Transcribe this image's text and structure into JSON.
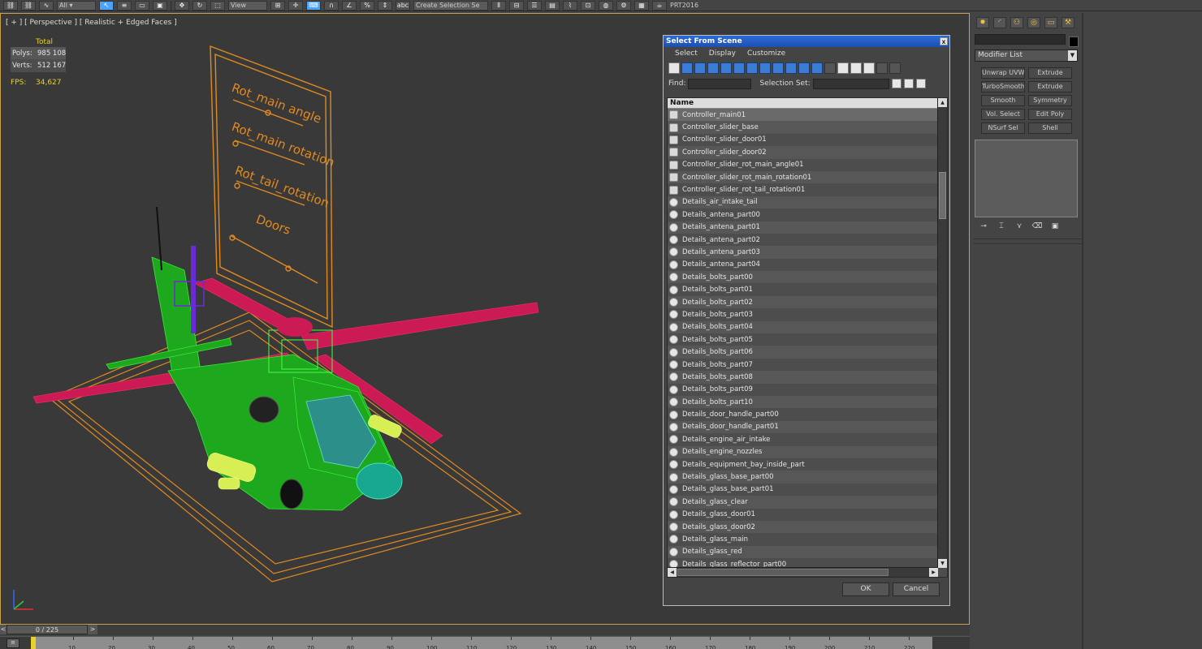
{
  "toolbar": {
    "view_dropdown": "View",
    "selection_set_field": "Create Selection Se",
    "render_label": "PRT2016"
  },
  "viewport": {
    "label": "[ + ] [ Perspective ] [ Realistic + Edged Faces ]",
    "stats": {
      "total_label": "Total",
      "polys_label": "Polys:",
      "polys_value": "985 108",
      "verts_label": "Verts:",
      "verts_value": "512 167",
      "fps_label": "FPS:",
      "fps_value": "34,627"
    },
    "board_labels": [
      "Rot_main angle",
      "Rot_main rotation",
      "Rot_tail_rotation",
      "Doors"
    ],
    "colors": {
      "stats": "#e8d22a",
      "wireframe": "#22cc22",
      "rotor": "#cc1a55",
      "board": "#e08a20",
      "border": "#c8a24a"
    }
  },
  "dialog": {
    "title": "Select From Scene",
    "close_glyph": "x",
    "menu": [
      "Select",
      "Display",
      "Customize"
    ],
    "find_label": "Find:",
    "selection_set_label": "Selection Set:",
    "column_name": "Name",
    "items": [
      "Controller_main01",
      "Controller_slider_base",
      "Controller_slider_door01",
      "Controller_slider_door02",
      "Controller_slider_rot_main_angle01",
      "Controller_slider_rot_main_rotation01",
      "Controller_slider_rot_tail_rotation01",
      "Details_air_intake_tail",
      "Details_antena_part00",
      "Details_antena_part01",
      "Details_antena_part02",
      "Details_antena_part03",
      "Details_antena_part04",
      "Details_bolts_part00",
      "Details_bolts_part01",
      "Details_bolts_part02",
      "Details_bolts_part03",
      "Details_bolts_part04",
      "Details_bolts_part05",
      "Details_bolts_part06",
      "Details_bolts_part07",
      "Details_bolts_part08",
      "Details_bolts_part09",
      "Details_bolts_part10",
      "Details_door_handle_part00",
      "Details_door_handle_part01",
      "Details_engine_air_intake",
      "Details_engine_nozzles",
      "Details_equipment_bay_inside_part",
      "Details_glass_base_part00",
      "Details_glass_base_part01",
      "Details_glass_clear",
      "Details_glass_door01",
      "Details_glass_door02",
      "Details_glass_main",
      "Details_glass_red",
      "Details_glass_reflector_part00"
    ],
    "ok_label": "OK",
    "cancel_label": "Cancel"
  },
  "command_panel": {
    "modifier_list": "Modifier List",
    "modifiers": [
      "Unwrap UVW",
      "Extrude",
      "TurboSmooth",
      "Extrude",
      "Smooth",
      "Symmetry",
      "Vol. Select",
      "Edit Poly",
      "NSurf Sel",
      "Shell"
    ]
  },
  "timeline": {
    "frame_counter": "0 / 225",
    "left_arrow": "<",
    "right_arrow": ">",
    "ticks": [
      "10",
      "20",
      "30",
      "40",
      "50",
      "60",
      "70",
      "80",
      "90",
      "100",
      "110",
      "120",
      "130",
      "140",
      "150",
      "160",
      "170",
      "180",
      "190",
      "200",
      "210",
      "220"
    ]
  }
}
